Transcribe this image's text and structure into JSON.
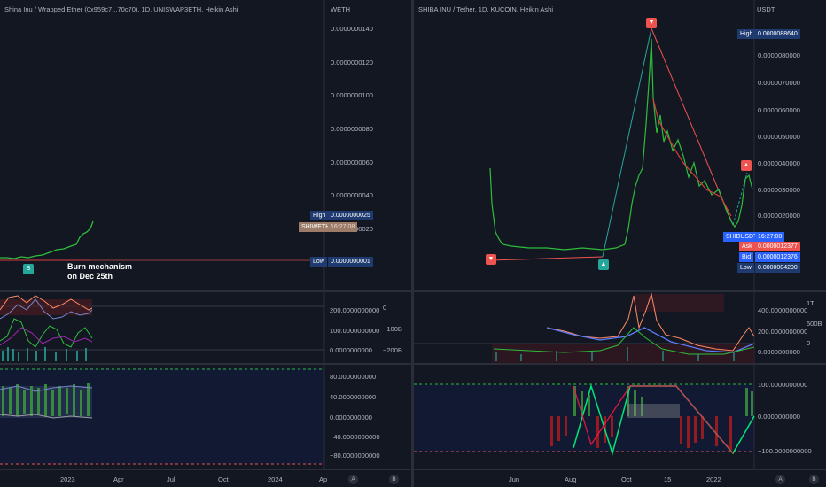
{
  "colors": {
    "bg": "#131722",
    "grid": "#1e222d",
    "bull": "#26a69a",
    "bear": "#ef5350",
    "green_candle": "#2ebd3b",
    "red_candle": "#d63d3d",
    "label_blue": "#1e3a6e",
    "label_tan": "#9c7c68"
  },
  "left_chart": {
    "title": "Shina Inu / Wrapped Ether (0x959c7...70c70), 1D, UNISWAP3ETH, Heikin Ashi",
    "axis_unit": "WETH",
    "price_ticks": [
      "0.0000000140",
      "0.0000000120",
      "0.0000000100",
      "0.0000000080",
      "0.0000000060",
      "0.0000000040",
      "0.0000000020"
    ],
    "high_label": "High",
    "high_value": "0.0000000025",
    "symbol_label": "SHIWETH",
    "symbol_time": "16:27:08",
    "low_label": "Low",
    "low_value": "0.0000000001",
    "marker_buy": "S",
    "annotation_line1": "Burn mechanism",
    "annotation_line2": "on Dec 25th",
    "osc_ticks": [
      "200.0000000000",
      "100.0000000000",
      "0.0000000000"
    ],
    "osc_ticks2": [
      "0",
      "−100B",
      "−200B"
    ],
    "osc2_ticks": [
      "80.0000000000",
      "40.0000000000",
      "0.0000000000",
      "−40.0000000000",
      "−80.0000000000"
    ],
    "time_ticks": [
      "2023",
      "Apr",
      "Jul",
      "Oct",
      "2024",
      "Ap"
    ],
    "btn_a": "A",
    "btn_b": "B"
  },
  "right_chart": {
    "title": "SHIBA INU / Tether, 1D, KUCOIN, Heikin Ashi",
    "axis_unit": "USDT",
    "price_ticks": [
      "0.0000080000",
      "0.0000070000",
      "0.0000060000",
      "0.0000050000",
      "0.0000040000",
      "0.0000030000",
      "0.0000020000"
    ],
    "high_label": "High",
    "high_value": "0.0000088640",
    "symbol_label": "SHIBUSDT",
    "symbol_time": "16:27:08",
    "ask_label": "Ask",
    "ask_value": "0.0000012377",
    "bid_label": "Bid",
    "bid_value": "0.0000012376",
    "low_label": "Low",
    "low_value": "0.0000004290",
    "osc_ticks": [
      "400.0000000000",
      "200.0000000000",
      "0.0000000000"
    ],
    "osc_ticks2": [
      "1T",
      "500B",
      "0"
    ],
    "osc2_ticks": [
      "100.0000000000",
      "0.0000000000",
      "−100.0000000000"
    ],
    "time_ticks": [
      "Jun",
      "Aug",
      "Oct",
      "15",
      "2022"
    ],
    "btn_a": "A",
    "btn_b": "B",
    "chart_data": {
      "type": "line",
      "title": "SHIBA INU / Tether, 1D, KUCOIN, Heikin Ashi",
      "ylabel": "USDT",
      "high": 8.864e-06,
      "low": 4.29e-07
    }
  }
}
